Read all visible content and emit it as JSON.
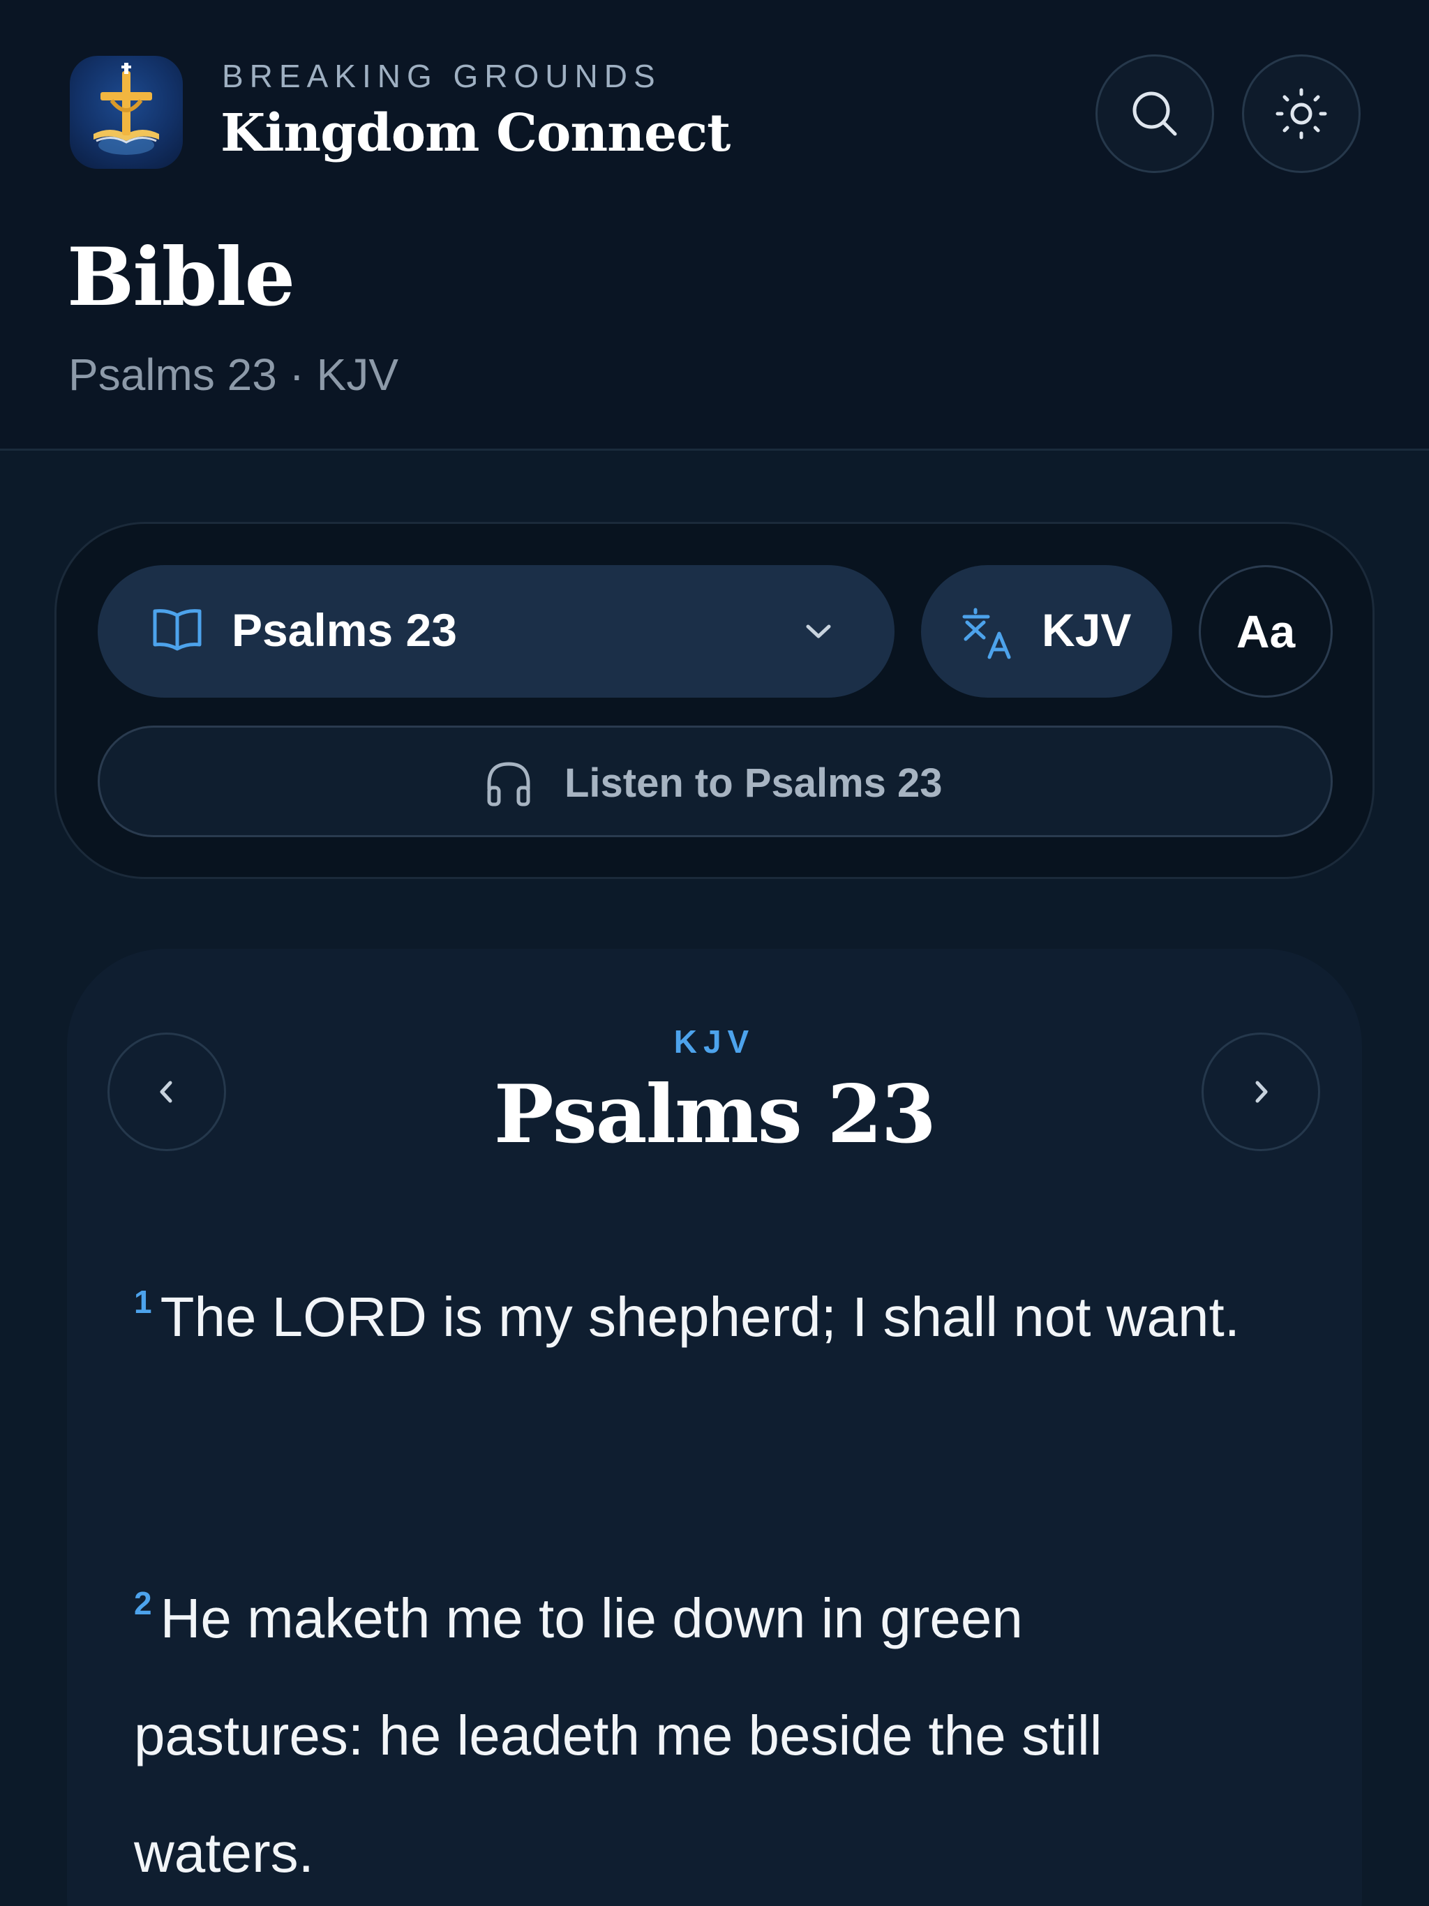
{
  "header": {
    "eyebrow": "BREAKING GROUNDS",
    "app_name": "Kingdom Connect",
    "logo_icon": "cross-over-open-book-logo",
    "search_icon": "search-icon",
    "theme_icon": "sun-icon"
  },
  "page": {
    "title": "Bible",
    "subtitle": "Psalms 23 · KJV"
  },
  "controls": {
    "book_select": "Psalms 23",
    "translation": "KJV",
    "font_size_label": "Aa",
    "listen_label": "Listen to Psalms 23"
  },
  "reader": {
    "translation": "KJV",
    "chapter_title": "Psalms 23",
    "verses": [
      {
        "number": "1",
        "text": "The LORD is my shepherd; I shall not want."
      },
      {
        "number": "2",
        "text": "He maketh me to lie down in green pastures: he leadeth me beside the still waters."
      }
    ]
  },
  "colors": {
    "background": "#0c1a29",
    "accent": "#4da3ec",
    "card": "#0f1e30",
    "pill": "#1b2f48"
  }
}
